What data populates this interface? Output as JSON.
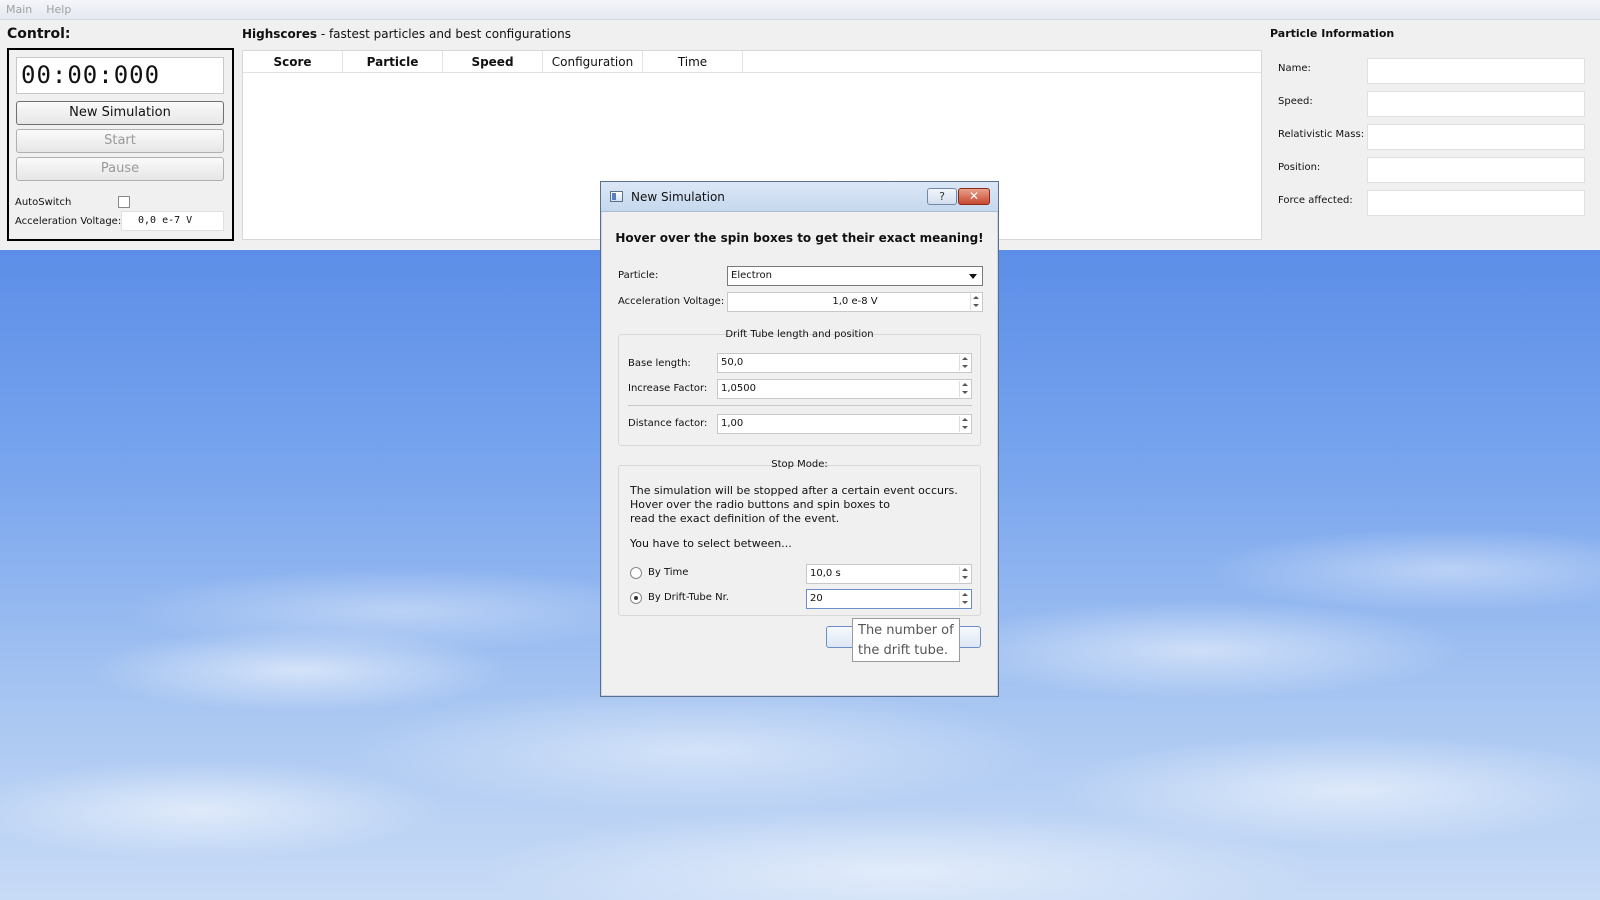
{
  "menubar": {
    "items": [
      "Main",
      "Help"
    ]
  },
  "control": {
    "title": "Control:",
    "timer": "00:00:000",
    "new_simulation_label": "New Simulation",
    "start_label": "Start",
    "pause_label": "Pause",
    "autoswitch_label": "AutoSwitch",
    "autoswitch_checked": false,
    "accel_label": "Acceleration Voltage:",
    "accel_value": "0,0 e-7 V"
  },
  "highscores": {
    "title": "Highscores",
    "subtitle": " - fastest particles and best configurations",
    "columns": [
      "Score",
      "Particle",
      "Speed",
      "Configuration",
      "Time"
    ],
    "rows": []
  },
  "particle_info": {
    "title": "Particle Information",
    "fields": [
      {
        "label": "Name:",
        "value": ""
      },
      {
        "label": "Speed:",
        "value": ""
      },
      {
        "label": "Relativistic Mass:",
        "value": ""
      },
      {
        "label": "Position:",
        "value": ""
      },
      {
        "label": "Force affected:",
        "value": ""
      }
    ]
  },
  "dialog": {
    "title": "New Simulation",
    "help_symbol": "?",
    "close_symbol": "✕",
    "hint": "Hover over the spin boxes to get their exact meaning!",
    "particle_label": "Particle:",
    "particle_value": "Electron",
    "accel_label": "Acceleration Voltage:",
    "accel_value": "1,0 e-8  V",
    "drift_group_title": "Drift Tube length and position",
    "base_length_label": "Base length:",
    "base_length_value": "50,0",
    "increase_factor_label": "Increase Factor:",
    "increase_factor_value": "1,0500",
    "distance_factor_label": "Distance factor:",
    "distance_factor_value": "1,00",
    "stop_group_title": "Stop Mode:",
    "stop_description_1": "The simulation will be stopped after a certain event occurs.",
    "stop_description_2": "Hover over the radio buttons and spin boxes to",
    "stop_description_3": "read the exact definition of the event.",
    "stop_select_text": "You have to select between...",
    "by_time_label": "By Time",
    "by_time_value": "10,0 s",
    "by_time_selected": false,
    "by_tube_label": "By Drift-Tube Nr.",
    "by_tube_value": "20",
    "by_tube_selected": true,
    "tooltip_line1": "The number of",
    "tooltip_line2": "the drift tube."
  }
}
